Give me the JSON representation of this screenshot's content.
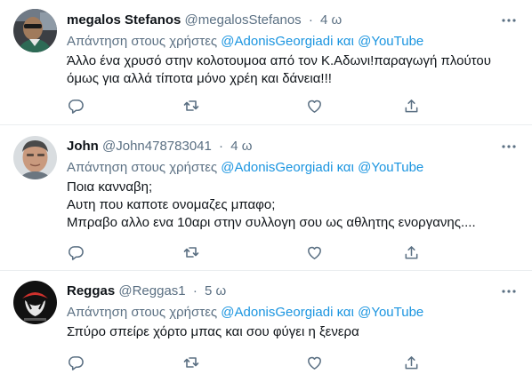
{
  "tweets": [
    {
      "name": "megalos Stefanos",
      "handle": "@megalosStefanos",
      "separator": "·",
      "time": "4 ω",
      "reply_prefix": "Απάντηση στους χρήστες",
      "mention_1": "@AdonisGeorgiadi",
      "conjunction": "και",
      "mention_2": "@YouTube",
      "lines": [
        "Άλλο ένα χρυσό στην κολοτουμοα από τον Κ.Αδωνι!παραγωγή πλούτου",
        "όμως για αλλά τίποτα μόνο χρέη και δάνεια!!!"
      ]
    },
    {
      "name": "John",
      "handle": "@John478783041",
      "separator": "·",
      "time": "4 ω",
      "reply_prefix": "Απάντηση στους χρήστες",
      "mention_1": "@AdonisGeorgiadi",
      "conjunction": "και",
      "mention_2": "@YouTube",
      "lines": [
        "Ποια κανναβη;",
        "Αυτη που καποτε ονομαζες μπαφο;",
        "Μπραβο αλλο ενα 10αρι στην συλλογη σου ως αθλητης ενοργανης...."
      ]
    },
    {
      "name": "Reggas",
      "handle": "@Reggas1",
      "separator": "·",
      "time": "5 ω",
      "reply_prefix": "Απάντηση στους χρήστες",
      "mention_1": "@AdonisGeorgiadi",
      "conjunction": "και",
      "mention_2": "@YouTube",
      "lines": [
        "Σπύρο σπείρε χόρτο μπας και σου φύγει η ξενερα"
      ]
    }
  ],
  "icons": {
    "more": "more-dots-icon",
    "reply": "reply-bubble-icon",
    "retweet": "retweet-icon",
    "like": "heart-icon",
    "share": "share-icon"
  },
  "colors": {
    "link": "#1b95e0",
    "secondary_text": "#5b7083",
    "primary_text": "#0f1419",
    "divider": "#ebeef0"
  }
}
